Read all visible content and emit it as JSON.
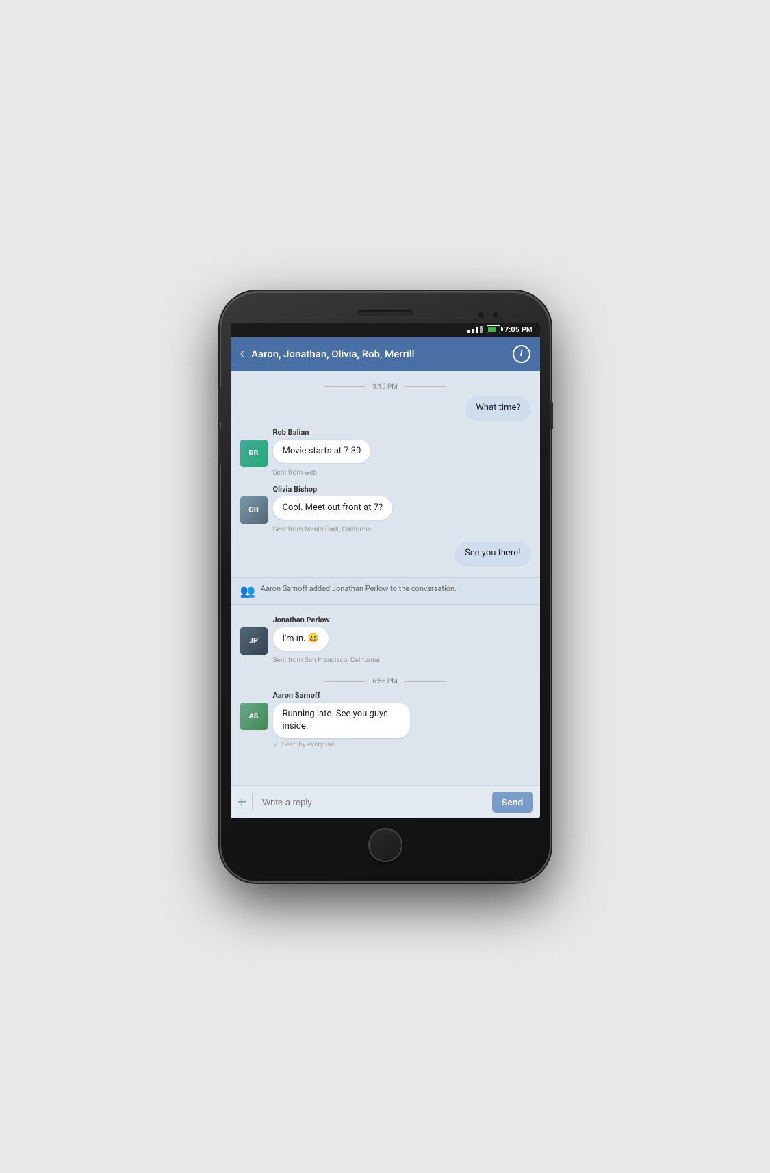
{
  "status_bar": {
    "time": "7:05 PM"
  },
  "header": {
    "title": "Aaron, Jonathan, Olivia, Rob, Merrill",
    "back_label": "‹",
    "info_label": "i"
  },
  "messages": [
    {
      "type": "timestamp",
      "text": "3:15 PM"
    },
    {
      "type": "sent",
      "text": "What time?"
    },
    {
      "type": "received",
      "sender": "Rob Balian",
      "text": "Movie starts at 7:30",
      "sub": "Sent from web",
      "avatar_initials": "RB",
      "avatar_color": "#4a9"
    },
    {
      "type": "received",
      "sender": "Olivia Bishop",
      "text": "Cool. Meet out front at 7?",
      "sub": "Sent from Menlo Park, California",
      "avatar_initials": "OB",
      "avatar_color": "#79a"
    },
    {
      "type": "sent",
      "text": "See you there!"
    },
    {
      "type": "system",
      "text": "Aaron Sarnoff added Jonathan Perlow to the conversation."
    },
    {
      "type": "received",
      "sender": "Jonathan Perlow",
      "text": "I'm in. 😀",
      "sub": "Sent from San Francisco, California",
      "avatar_initials": "JP",
      "avatar_color": "#567"
    },
    {
      "type": "timestamp",
      "text": "6:56 PM"
    },
    {
      "type": "received",
      "sender": "Aaron Sarnoff",
      "text": "Running late. See you guys inside.",
      "sub": "Seen by everyone.",
      "seen": true,
      "avatar_initials": "AS",
      "avatar_color": "#6a8"
    }
  ],
  "input_bar": {
    "placeholder": "Write a reply",
    "send_label": "Send",
    "plus_label": "+"
  }
}
